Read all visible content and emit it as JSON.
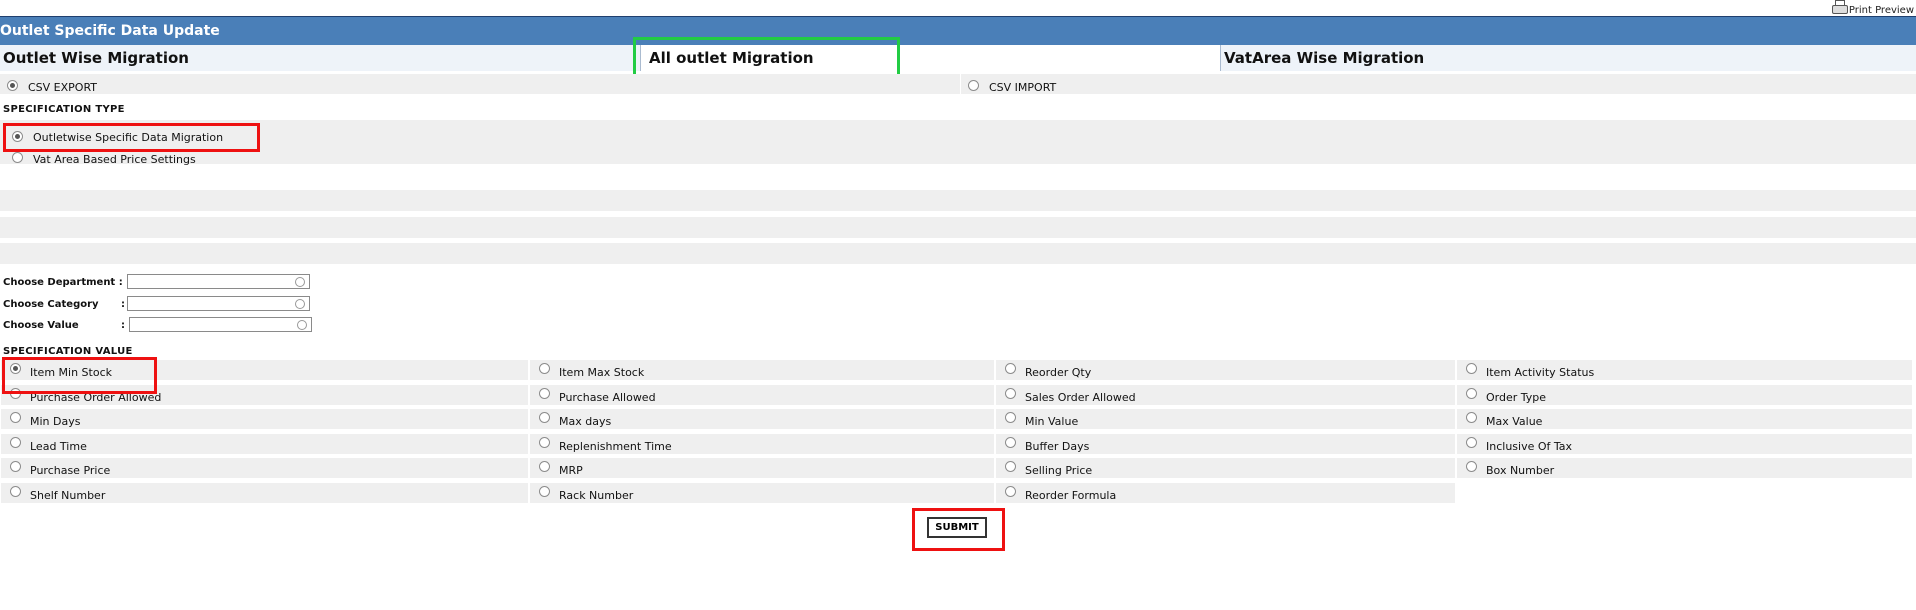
{
  "print_preview": "Print Preview",
  "header": {
    "title": "Outlet Specific Data Update"
  },
  "tabs": [
    {
      "label": "Outlet Wise Migration"
    },
    {
      "label": "All outlet Migration"
    },
    {
      "label": "VatArea Wise Migration"
    }
  ],
  "csv": {
    "export_label": "CSV EXPORT",
    "import_label": "CSV IMPORT",
    "selected": "CSV EXPORT"
  },
  "specification_type": {
    "title": "SPECIFICATION TYPE",
    "options": [
      "Outletwise Specific Data Migration",
      "Vat Area Based Price Settings"
    ],
    "selected": "Outletwise Specific Data Migration"
  },
  "filters": {
    "department_label": "Choose Department :",
    "category_label": "Choose Category",
    "value_label": "Choose Value",
    "colon": ":",
    "department_value": "",
    "category_value": "",
    "value_value": ""
  },
  "specification_value": {
    "title": "SPECIFICATION VALUE",
    "selected": "Item Min Stock",
    "rows": [
      [
        "Item Min Stock",
        "Item Max Stock",
        "Reorder Qty",
        "Item Activity Status"
      ],
      [
        "Purchase Order Allowed",
        "Purchase Allowed",
        "Sales Order Allowed",
        "Order Type"
      ],
      [
        "Min Days",
        "Max days",
        "Min Value",
        "Max Value"
      ],
      [
        "Lead Time",
        "Replenishment Time",
        "Buffer Days",
        "Inclusive Of Tax"
      ],
      [
        "Purchase Price",
        "MRP",
        "Selling Price",
        "Box Number"
      ],
      [
        "Shelf Number",
        "Rack Number",
        "Reorder Formula"
      ]
    ]
  },
  "submit_label": "SUBMIT",
  "colors": {
    "header": "#4a7fb8",
    "row_gray": "#efefef",
    "highlight_red": "#ee1111",
    "highlight_green": "#22cc44"
  }
}
